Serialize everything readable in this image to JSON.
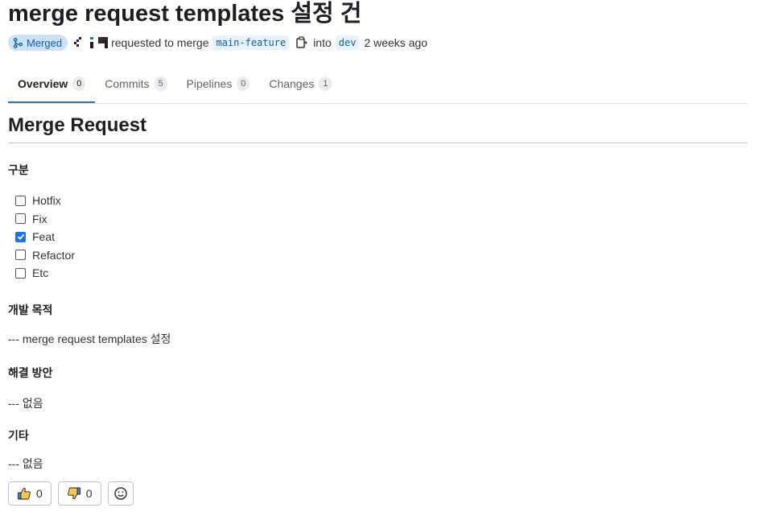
{
  "title": "merge request templates 설정 건",
  "meta": {
    "status_badge": "Merged",
    "requested_text": "requested to merge",
    "source_branch": "main-feature",
    "into_text": "into",
    "target_branch": "dev",
    "time_ago": "2 weeks ago"
  },
  "tabs": [
    {
      "label": "Overview",
      "count": "0",
      "active": true
    },
    {
      "label": "Commits",
      "count": "5",
      "active": false
    },
    {
      "label": "Pipelines",
      "count": "0",
      "active": false
    },
    {
      "label": "Changes",
      "count": "1",
      "active": false
    }
  ],
  "description": {
    "heading": "Merge Request",
    "section1": {
      "title": "구분",
      "items": [
        {
          "label": "Hotfix",
          "checked": false
        },
        {
          "label": "Fix",
          "checked": false
        },
        {
          "label": "Feat",
          "checked": true
        },
        {
          "label": "Refactor",
          "checked": false
        },
        {
          "label": "Etc",
          "checked": false
        }
      ]
    },
    "section2": {
      "title": "개발 목적",
      "text": "--- merge request templates 설정"
    },
    "section3": {
      "title": "해결 방안",
      "text": "--- 없음"
    },
    "section4": {
      "title": "기타",
      "text": "--- 없음"
    }
  },
  "reactions": {
    "thumbs_up_count": "0",
    "thumbs_down_count": "0"
  },
  "colors": {
    "accent": "#1f75cb",
    "merged_badge_bg": "#cbe2f9",
    "merged_badge_text": "#0b5cad",
    "checkbox_checked": "#1a73e8"
  },
  "icons": {
    "merged": "merge-icon",
    "copy": "copy-icon",
    "thumbs_up": "thumbs-up-icon",
    "thumbs_down": "thumbs-down-icon",
    "emoji": "smiley-icon"
  }
}
